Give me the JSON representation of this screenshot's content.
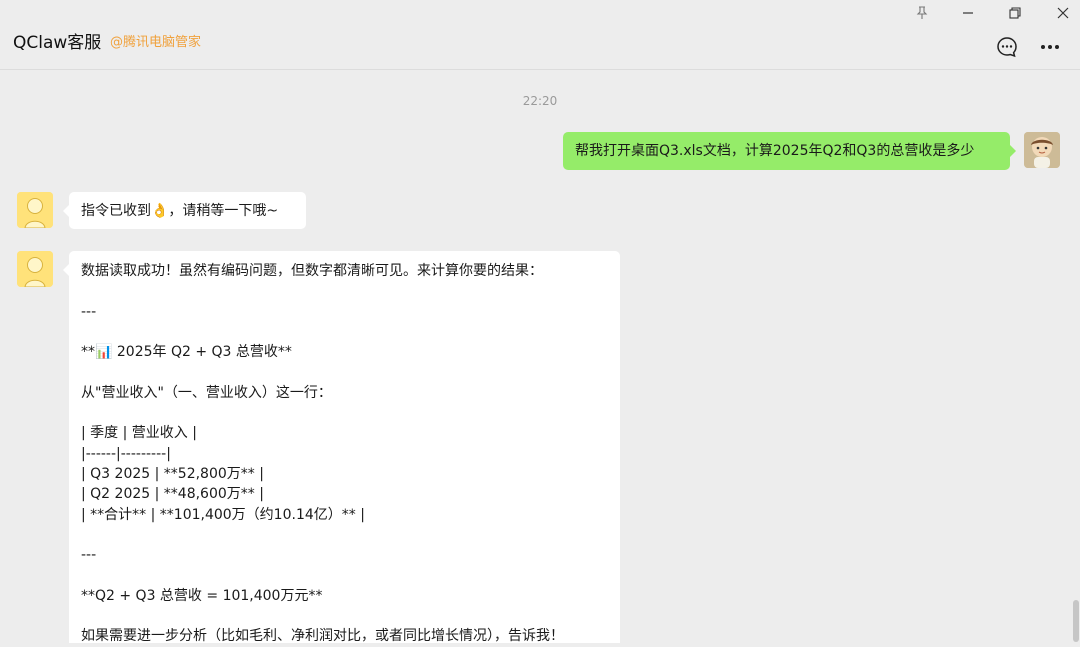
{
  "header": {
    "title": "QClaw客服",
    "subtitle": "@腾讯电脑管家"
  },
  "window_controls": [
    "pin-icon",
    "minimize-icon",
    "restore-icon",
    "close-icon"
  ],
  "header_actions": [
    "chat-bubble-icon",
    "more-icon"
  ],
  "timestamp": "22:20",
  "messages": [
    {
      "sender": "user",
      "text": "帮我打开桌面Q3.xls文档，计算2025年Q2和Q3的总营收是多少"
    },
    {
      "sender": "bot",
      "text": "指令已收到👌，请稍等一下哦~"
    },
    {
      "sender": "bot",
      "lines": [
        "数据读取成功！虽然有编码问题，但数字都清晰可见。来计算你要的结果：",
        "",
        "---",
        "",
        "**📊 2025年 Q2 + Q3 总营收**",
        "",
        "从\"营业收入\"（一、营业收入）这一行：",
        "",
        "| 季度 | 营业收入 |",
        "|------|---------|",
        "| Q3 2025 | **52,800万** |",
        "| Q2 2025 | **48,600万** |",
        "| **合计** | **101,400万（约10.14亿）** |",
        "",
        "---",
        "",
        "**Q2 + Q3 总营收 = 101,400万元**",
        "",
        "如果需要进一步分析（比如毛利、净利润对比，或者同比增长情况），告诉我！"
      ]
    }
  ],
  "colors": {
    "background": "#ededed",
    "user_bubble": "#95ec69",
    "bot_bubble": "#ffffff",
    "subtitle": "#f0a13c"
  }
}
